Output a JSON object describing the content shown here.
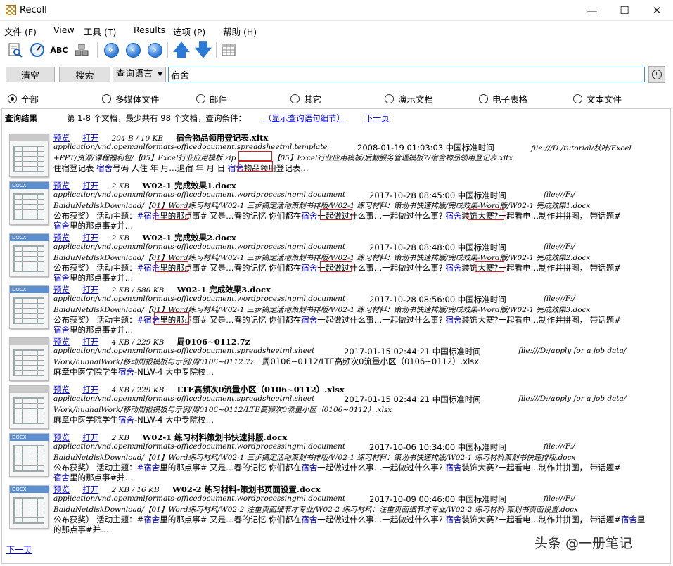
{
  "window": {
    "title": "Recoll"
  },
  "menu": [
    "文件 (F)",
    "View",
    "工具 (T)",
    "Results",
    "选项 (P)",
    "帮助 (H)"
  ],
  "search": {
    "clear_label": "清空",
    "search_label": "搜索",
    "mode": "查询语言",
    "query": "宿舍"
  },
  "filters": {
    "selected": "全部",
    "items": [
      "全部",
      "多媒体文件",
      "邮件",
      "其它",
      "演示文档",
      "电子表格",
      "文本文件"
    ]
  },
  "results_header": {
    "title": "查询结果",
    "stats": "第 1-8 个文档，最少共有 98 个文档，查询条件：",
    "show_query_link": "（显示查询语句细节）",
    "next_link": "下一页"
  },
  "preview_label": "预览",
  "open_label": "打开",
  "results": [
    {
      "size": "204 B / 10 KB",
      "name": "宿舍物品领用登记表.xltx",
      "mime": "application/vnd.openxmlformats-officedocument.spreadsheetml.template",
      "date": "2008-01-19  01:03:03  中国标准时间",
      "path1": "file:///D:/tutorial/秋叶/Excel",
      "path2": "+PPT/资源/课程福利包/【05】Excel行业应用模板.zip",
      "path2b": "【05】Excel行业应用模板/后勤服务管理模板7/宿舍物品领用登记表.xltx",
      "snippet_parts": [
        "住宿登记表 ",
        "宿舍",
        "号码 人住 年 月…退宿 年 月 日 ",
        "宿舍",
        "物品领用登记表…"
      ]
    },
    {
      "size": "2 KB",
      "name": "W02-1 完成效果1.docx",
      "mime": "application/vnd.openxmlformats-officedocument.wordprocessingml.document",
      "date": "2017-10-28  08:45:00  中国标准时间",
      "path1": "file:///F:/",
      "path2": "BaiduNetdiskDownload/【01】Word练习材料/W02-1 三步搞定活动策划书排版/W02-1 练习材料：策划书快速排版/完成效果-Word版/W02-1 完成效果1.docx",
      "snippet_parts": [
        "公布获奖）        活动主题：",
        "#宿舍",
        "里的那点事# 又是…春的记忆 你们都在",
        "宿舍",
        "一起做过什么事…一起做过什么事? ",
        "宿舍",
        "装饰大赛?一起看电…制作并拼图，  带话题#"
      ],
      "snippet2_parts": [
        "宿舍",
        "里的那点事#并…"
      ]
    },
    {
      "size": "2 KB",
      "name": "W02-1 完成效果2.docx",
      "mime": "application/vnd.openxmlformats-officedocument.wordprocessingml.document",
      "date": "2017-10-28  08:48:00  中国标准时间",
      "path1": "file:///F:/",
      "path2": "BaiduNetdiskDownload/【01】Word练习材料/W02-1 三步搞定活动策划书排版/W02-1 练习材料：策划书快速排版/完成效果-Word版/W02-1 完成效果2.docx",
      "snippet_parts": [
        "公布获奖）        活动主题：",
        "#宿舍",
        "里的那点事# 又是…春的记忆 你们都在",
        "宿舍",
        "一起做过什么事…一起做过什么事? ",
        "宿舍",
        "装饰大赛?一起看电…制作并拼图，  带话题#"
      ],
      "snippet2_parts": [
        "宿舍",
        "里的那点事#并…"
      ]
    },
    {
      "size": "2 KB / 580 KB",
      "name": "W02-1 完成效果3.docx",
      "mime": "application/vnd.openxmlformats-officedocument.wordprocessingml.document",
      "date": "2017-10-28  08:56:00  中国标准时间",
      "path1": "file:///F:/",
      "path2": "BaiduNetdiskDownload/【01】Word练习材料/W02-1 三步搞定活动策划书排版/W02-1 练习材料：策划书快速排版/完成效果-Word版/W02-1 完成效果3.docx",
      "snippet_parts": [
        "公布获奖）        活动主题：",
        "#宿舍",
        "里的那点事# 又是…春的记忆 你们都在",
        "宿舍",
        "一起做过什么事…一起做过什么事? ",
        "宿舍",
        "装饰大赛?一起看电…制作并拼图，  带话题#"
      ],
      "snippet2_parts": [
        "宿舍",
        "里的那点事#并…"
      ]
    },
    {
      "size": "4 KB / 229 KB",
      "name": "周0106~0112.7z",
      "mime": "application/vnd.openxmlformats-officedocument.spreadsheetml.sheet",
      "date": "2017-01-15  02:44:21  中国标准时间",
      "path1": "file:///D:/apply for a job data/",
      "path2": "Work/huahaiWork/移动周报模板与示例/周0106~0112.7z",
      "path2b": "  周0106~0112/LTE高频次0流量小区（0106~0112）.xlsx",
      "snippet_parts": [
        "麻章中医学院学生",
        "宿舍",
        "-NLW-4 大中专院校…"
      ]
    },
    {
      "size": "4 KB / 229 KB",
      "name": "LTE高频次0流量小区（0106~0112）.xlsx",
      "mime": "application/vnd.openxmlformats-officedocument.spreadsheetml.sheet",
      "date": "2017-01-15  02:44:21  中国标准时间",
      "path1": "file:///D:/apply for a job data/",
      "path2": "Work/huahaiWork/移动周报模板与示例/周0106~0112/LTE高频次0流量小区（0106~0112）.xlsx",
      "snippet_parts": [
        "麻章中医学院学生",
        "宿舍",
        "-NLW-4 大中专院校…"
      ]
    },
    {
      "size": "2 KB",
      "name": "W02-1 练习材料策划书快速排版.docx",
      "mime": "application/vnd.openxmlformats-officedocument.wordprocessingml.document",
      "date": "2017-10-06  10:34:00  中国标准时间",
      "path1": "file:///F:/",
      "path2": "BaiduNetdiskDownload/【01】Word练习材料/W02-1 三步搞定活动策划书排版/W02-1 练习材料：策划书快速排版/W02-1 练习材料策划书快速排版.docx",
      "snippet_parts": [
        "公布获奖）        活动主题：",
        "#宿舍",
        "里的那点事# 又是…春的记忆 你们都在",
        "宿舍",
        "一起做过什么事…一起做过什么事? ",
        "宿舍",
        "装饰大赛?一起看电…制作并拼图，  带话题#"
      ],
      "snippet2_parts": [
        "宿舍",
        "里的那点事#并…"
      ]
    },
    {
      "size": "2 KB / 16 KB",
      "name": "W02-2 练习材料-策划书页面设置.docx",
      "mime": "application/vnd.openxmlformats-officedocument.wordprocessingml.document",
      "date": "2017-10-09  00:46:00  中国标准时间",
      "path1": "file:///F:/",
      "path2": "BaiduNetdiskDownload/【01】Word练习材料/W02-2 注重页面细节才专业/W02-2 练习材料：注重页面细节才专业/W02-2 练习材料-策划书页面设置.docx",
      "snippet_parts": [
        "公布获奖）  活动主题：#",
        "宿舍",
        "里的那点事# 又是…春的记忆 你们都在",
        "宿舍",
        "一起做过什么事…一起做过什么事? ",
        "宿舍",
        "装饰大赛?一起看电…制作并拼图，  带话题#",
        "宿舍",
        "里"
      ],
      "snippet2_parts": [
        "的那点事#并…"
      ]
    }
  ],
  "bottom_next_link": "下一页",
  "watermark": "头条 @一册笔记"
}
